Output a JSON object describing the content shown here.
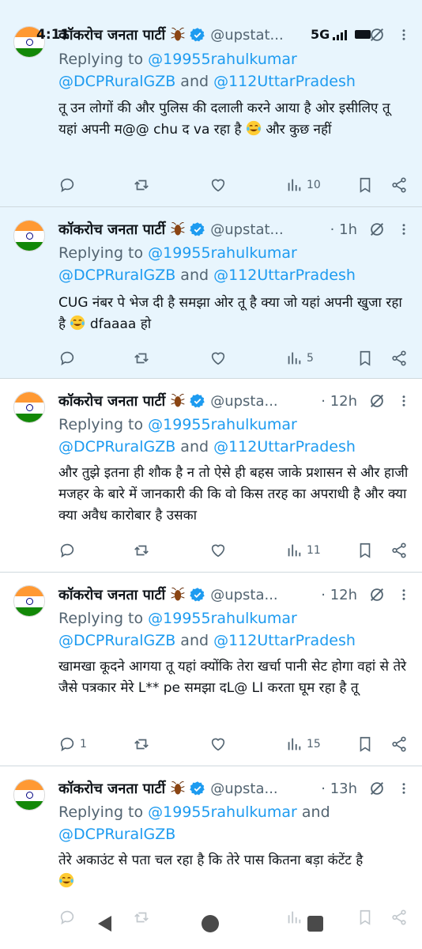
{
  "status_bar": {
    "time": "4:11",
    "network": "5G",
    "battery_icon": "battery-icon"
  },
  "colors": {
    "link": "#1d9bf0",
    "secondary": "#536471",
    "highlight_bg": "#e8f5fd",
    "divider": "#cfd9de"
  },
  "tweets": [
    {
      "name": "कॉकरोच जनता पार्टी",
      "handle": "@upstat...",
      "time": "",
      "replying_prefix": "Replying to ",
      "replying_links": [
        "@19955rahulkumar",
        "@DCPRuralGZB",
        "@112UttarPradesh"
      ],
      "and_word": " and ",
      "text": "तू उन लोगों की और पुलिस की दलाली करने आया है ओर इसीलिए तू यहां अपनी म@@ chu द va रहा है",
      "text_after": " और कुछ नहीं",
      "replies": "",
      "views": "10"
    },
    {
      "name": "कॉकरोच जनता पार्टी",
      "handle": "@upstat...",
      "time": "1h",
      "replying_prefix": "Replying to ",
      "replying_links": [
        "@19955rahulkumar",
        "@DCPRuralGZB",
        "@112UttarPradesh"
      ],
      "and_word": " and ",
      "text": "CUG नंबर पे भेज दी है समझा ओर तू है क्या जो यहां अपनी खुजा रहा है",
      "text_after": " dfaaaa हो",
      "replies": "",
      "views": "5"
    },
    {
      "name": "कॉकरोच जनता पार्टी",
      "handle": "@upsta...",
      "time": "12h",
      "replying_prefix": "Replying to ",
      "replying_links": [
        "@19955rahulkumar",
        "@DCPRuralGZB",
        "@112UttarPradesh"
      ],
      "and_word": " and ",
      "text": "और तुझे इतना ही शौक है न तो ऐसे ही बहस जाके प्रशासन से और हाजी मजहर के बारे में जानकारी की कि वो किस तरह का अपराधी है और क्या क्या अवैध कारोबार है उसका",
      "text_after": "",
      "replies": "",
      "views": "11"
    },
    {
      "name": "कॉकरोच जनता पार्टी",
      "handle": "@upsta...",
      "time": "12h",
      "replying_prefix": "Replying to ",
      "replying_links": [
        "@19955rahulkumar",
        "@DCPRuralGZB",
        "@112UttarPradesh"
      ],
      "and_word": " and ",
      "text": "खामखा कूदने आगया तू यहां क्योंकि तेरा खर्चा पानी सेट होगा वहां से तेरे जैसे पत्रकार मेरे L** pe समझा दL@ LI करता घूम रहा है तू",
      "text_after": "",
      "replies": "1",
      "views": "15"
    },
    {
      "name": "कॉकरोच जनता पार्टी",
      "handle": "@upsta...",
      "time": "13h",
      "replying_prefix": "Replying to ",
      "replying_links": [
        "@19955rahulkumar",
        "@DCPRuralGZB"
      ],
      "and_word": " and ",
      "text": "तेरे अकाउंट से पता चल रहा है कि तेरे पास कितना बड़ा कंटेंट है",
      "text_after": "",
      "replies": "",
      "views": ""
    }
  ]
}
